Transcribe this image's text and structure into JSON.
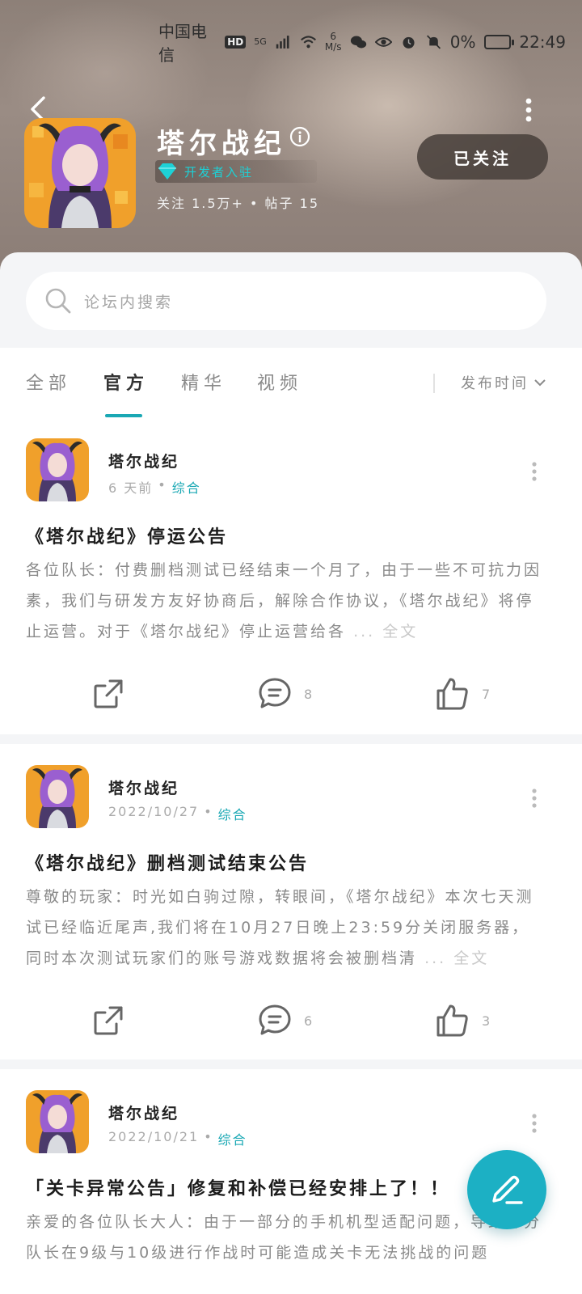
{
  "status_bar": {
    "carrier": "中国电信",
    "hd": "HD",
    "network": "5G",
    "speed_value": "6",
    "speed_unit": "M/s",
    "battery": "0%",
    "time": "22:49"
  },
  "header": {
    "forum_name": "塔尔战纪",
    "dev_badge": "开发者入驻",
    "stats": "关注 1.5万+ • 帖子 15",
    "follow_label": "已关注"
  },
  "search": {
    "placeholder": "论坛内搜索"
  },
  "tabs": [
    {
      "label": "全部",
      "active": false
    },
    {
      "label": "官方",
      "active": true
    },
    {
      "label": "精华",
      "active": false
    },
    {
      "label": "视频",
      "active": false
    }
  ],
  "sort": {
    "label": "发布时间"
  },
  "posts": [
    {
      "author": "塔尔战纪",
      "time": "6 天前",
      "category": "综合",
      "title": "《塔尔战纪》停运公告",
      "body": "各位队长：付费删档测试已经结束一个月了，由于一些不可抗力因素，我们与研发方友好协商后，解除合作协议，《塔尔战纪》将停止运营。对于《塔尔战纪》停止运营给各",
      "full_text": "... 全文",
      "comments": "8",
      "likes": "7"
    },
    {
      "author": "塔尔战纪",
      "time": "2022/10/27",
      "category": "综合",
      "title": "《塔尔战纪》删档测试结束公告",
      "body": "尊敬的玩家：时光如白驹过隙，转眼间，《塔尔战纪》本次七天测试已经临近尾声,我们将在10月27日晚上23:59分关闭服务器，同时本次测试玩家们的账号游戏数据将会被删档清",
      "full_text": "... 全文",
      "comments": "6",
      "likes": "3"
    },
    {
      "author": "塔尔战纪",
      "time": "2022/10/21",
      "category": "综合",
      "title": "「关卡异常公告」修复和补偿已经安排上了！！",
      "body": "亲爱的各位队长大人：由于一部分的手机机型适配问题，导致部分队长在9级与10级进行作战时可能造成关卡无法挑战的问题"
    }
  ],
  "colors": {
    "accent": "#1aa8b4",
    "fab": "#1cb0c4",
    "banner": "#8d8078"
  }
}
